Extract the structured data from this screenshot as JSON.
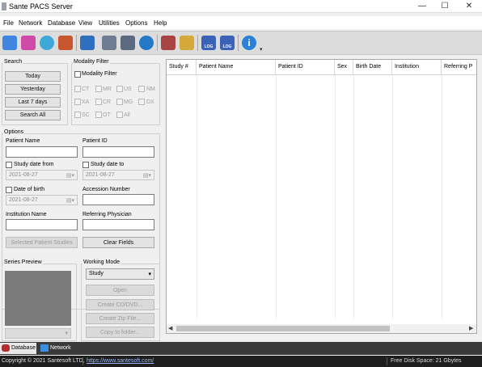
{
  "window": {
    "title": "Sante PACS Server",
    "minimize_glyph": "—",
    "maximize_glyph": "☐",
    "close_glyph": "✕"
  },
  "menu": [
    "File",
    "Network",
    "Database",
    "View",
    "Utilities",
    "Options",
    "Help"
  ],
  "toolbar": {
    "buttons": [
      {
        "icon": "import-icon",
        "color": "#3f86e0"
      },
      {
        "icon": "add-patient-icon",
        "color": "#d04aa8"
      },
      {
        "icon": "world-icon",
        "color": "#3da9d9"
      },
      {
        "icon": "grid-add-icon",
        "color": "#c7552f"
      },
      {
        "icon": "export-icon",
        "color": "#2f6fbd"
      },
      {
        "icon": "network-settings-icon",
        "color": "#6f7d92"
      },
      {
        "icon": "dicom-nodes-icon",
        "color": "#5b6a80"
      },
      {
        "icon": "tools-icon",
        "color": "#2478c8"
      },
      {
        "icon": "database-delete-icon",
        "color": "#a84444"
      },
      {
        "icon": "folder-settings-icon",
        "color": "#d4a93a"
      },
      {
        "icon": "log-icon",
        "color": "#3a63b8",
        "text": "LOG"
      },
      {
        "icon": "log-filter-icon",
        "color": "#3a63b8",
        "text": "LOG"
      },
      {
        "icon": "info-icon",
        "color": "#2a7fd6",
        "text": "i"
      }
    ],
    "more_glyph": "▾"
  },
  "search": {
    "group_label": "Search",
    "buttons": [
      "Today",
      "Yesterday",
      "Last 7 days",
      "Search All"
    ]
  },
  "modality": {
    "group_label": "Modality Filter",
    "enable_label": "Modality Filter",
    "items": [
      "CT",
      "MR",
      "US",
      "NM",
      "XA",
      "CR",
      "MG",
      "DX",
      "SC",
      "OT",
      "All"
    ]
  },
  "options": {
    "group_label": "Options",
    "patient_name_label": "Patient Name",
    "patient_id_label": "Patient ID",
    "study_date_from_label": "Study date from",
    "study_date_to_label": "Study date to",
    "study_date_from_value": "2021-08-27",
    "study_date_to_value": "2021-08-27",
    "dob_label": "Date of birth",
    "dob_value": "2021-08-27",
    "accession_label": "Accession Number",
    "institution_label": "Institution Name",
    "referring_label": "Referring Physician",
    "selected_studies_label": "Selected Patient Studies",
    "clear_fields_label": "Clear Fields",
    "calendar_glyph": "▤▾"
  },
  "preview": {
    "group_label": "Series Preview",
    "combo_arrow": "▾"
  },
  "working_mode": {
    "group_label": "Working Mode",
    "selected": "Study",
    "arrow": "▾",
    "buttons": [
      "Open",
      "Create CD/DVD...",
      "Create Zip File...",
      "Copy to folder..."
    ]
  },
  "table": {
    "columns": [
      "Study #",
      "Patient Name",
      "Patient ID",
      "Sex",
      "Birth Date",
      "Institution",
      "Referring P"
    ],
    "rows": [],
    "scroll_left": "◀",
    "scroll_right": "▶"
  },
  "tabs": [
    {
      "label": "Database",
      "active": true,
      "color": "#b03030"
    },
    {
      "label": "Network",
      "active": false,
      "color": "#3a8de0"
    }
  ],
  "status": {
    "copyright": "Copyright © 2021 Santesoft LTD,",
    "website": "https://www.santesoft.com/",
    "disk_space": "Free Disk Space: 21 Gbytes"
  }
}
